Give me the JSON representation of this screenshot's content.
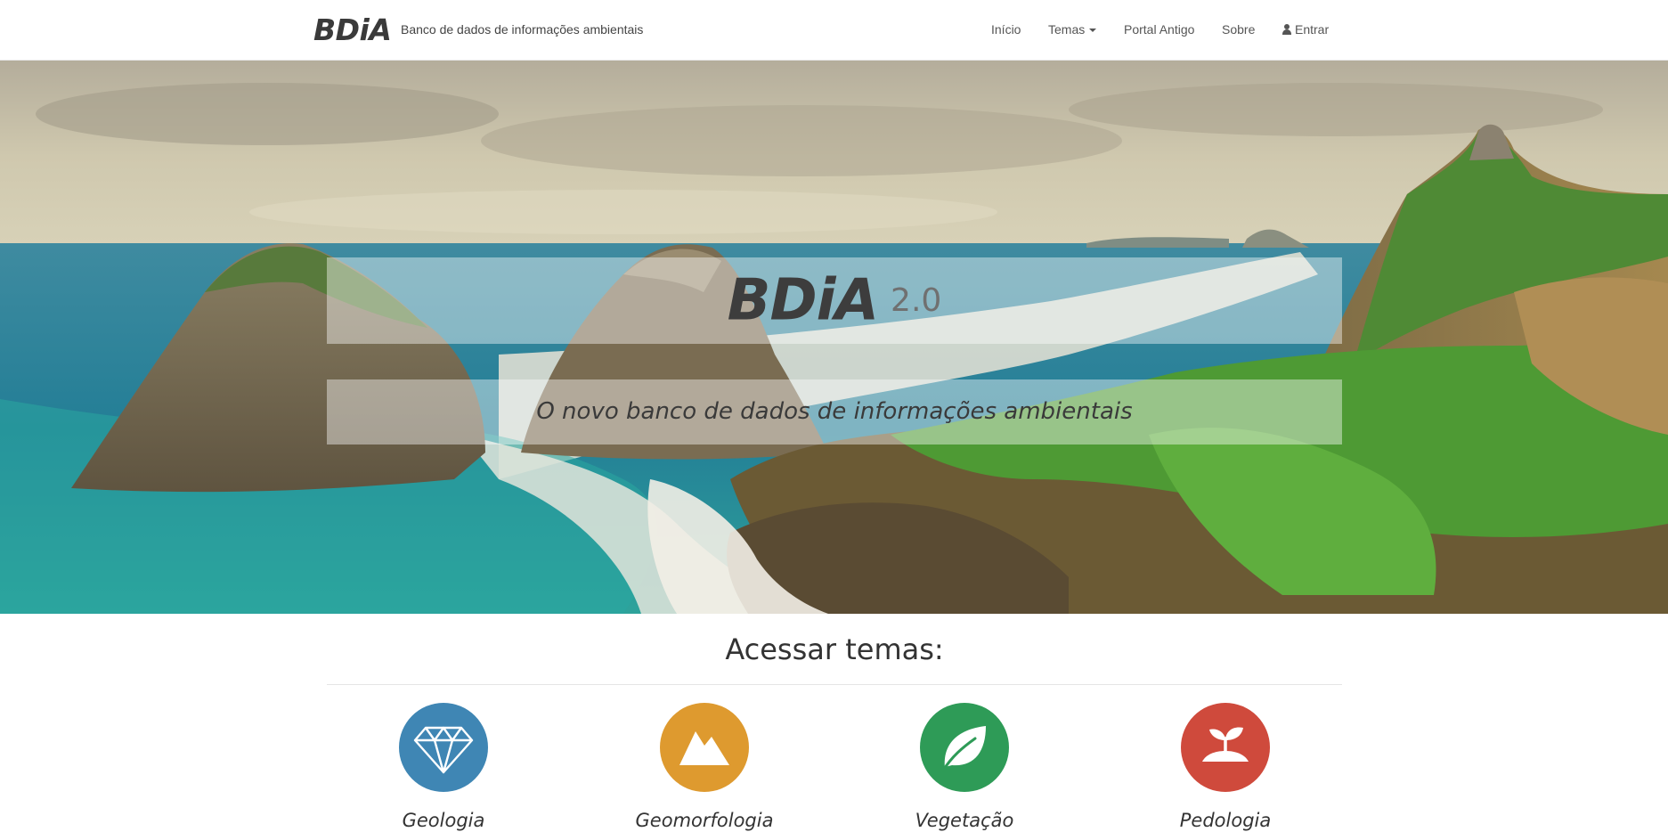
{
  "navbar": {
    "brand": "BDiA",
    "tagline": "Banco de dados de informações ambientais",
    "links": {
      "inicio": "Início",
      "temas": "Temas",
      "portal_antigo": "Portal Antigo",
      "sobre": "Sobre",
      "entrar": "Entrar"
    }
  },
  "hero": {
    "title": "BDiA",
    "version": "2.0",
    "subtitle": "O novo banco de dados de informações ambientais"
  },
  "themes": {
    "heading": "Acessar temas:",
    "items": [
      {
        "label": "Geologia",
        "icon": "diamond-icon",
        "color": "#3f86b4"
      },
      {
        "label": "Geomorfologia",
        "icon": "mountain-icon",
        "color": "#de9a2f"
      },
      {
        "label": "Vegetação",
        "icon": "leaf-icon",
        "color": "#2e9b57"
      },
      {
        "label": "Pedologia",
        "icon": "sprout-icon",
        "color": "#cf4a3c"
      }
    ]
  }
}
